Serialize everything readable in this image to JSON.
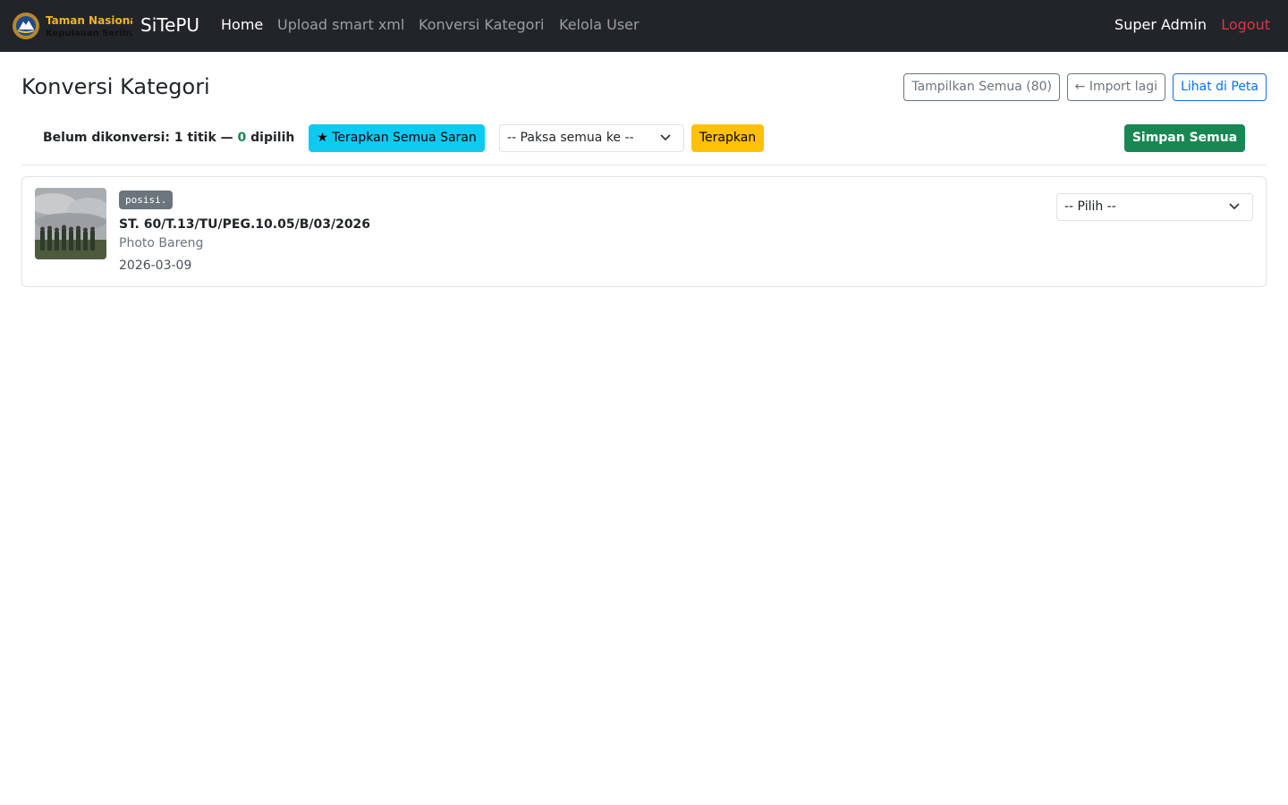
{
  "navbar": {
    "logo_text_line1": "Taman Nasional",
    "logo_text_line2": "Kepulauan Seribu",
    "brand": "SiTePU",
    "links": [
      {
        "label": "Home"
      },
      {
        "label": "Upload smart xml"
      },
      {
        "label": "Konversi Kategori"
      },
      {
        "label": "Kelola User"
      }
    ],
    "user": "Super Admin",
    "logout": "Logout"
  },
  "header": {
    "title": "Konversi Kategori",
    "btn_tampilkan": "Tampilkan Semua (80)",
    "btn_import": "← Import lagi",
    "btn_peta": "Lihat di Peta"
  },
  "toolbar": {
    "summary_prefix": "Belum dikonversi: 1 titik — ",
    "selected_count": "0",
    "summary_suffix": " dipilih",
    "btn_saran": "★ Terapkan Semua Saran",
    "select_paksa": "-- Paksa semua ke --",
    "btn_terapkan": "Terapkan",
    "btn_simpan": "Simpan Semua"
  },
  "items": [
    {
      "badge": "posisi.",
      "title": "ST. 60/T.13/TU/PEG.10.05/B/03/2026",
      "description": "Photo Bareng",
      "date": "2026-03-09",
      "select": "-- Pilih --"
    }
  ],
  "colors": {
    "navbar_bg": "#212529",
    "info": "#0dcaf0",
    "warning": "#ffc107",
    "success": "#198754",
    "danger": "#dc3545",
    "primary": "#0d6efd"
  }
}
